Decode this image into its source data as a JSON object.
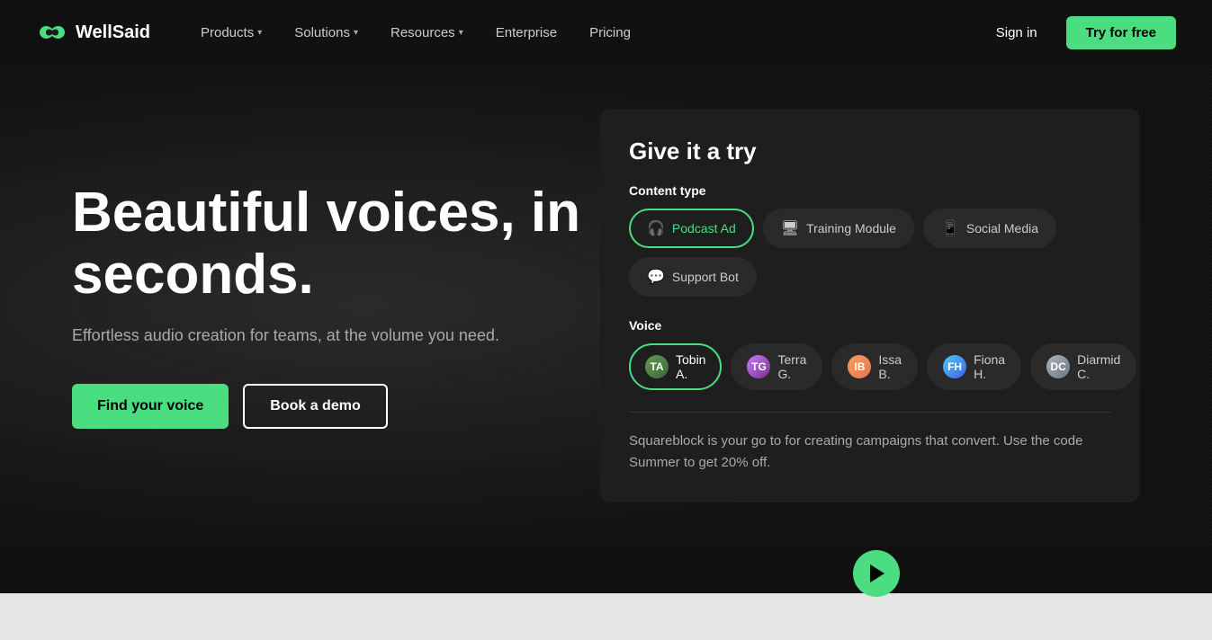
{
  "brand": {
    "name": "WellSaid",
    "logo_alt": "WellSaid logo"
  },
  "nav": {
    "items": [
      {
        "label": "Products",
        "has_dropdown": true
      },
      {
        "label": "Solutions",
        "has_dropdown": true
      },
      {
        "label": "Resources",
        "has_dropdown": true
      },
      {
        "label": "Enterprise",
        "has_dropdown": false
      },
      {
        "label": "Pricing",
        "has_dropdown": false
      }
    ],
    "sign_in": "Sign in",
    "try_free": "Try for free"
  },
  "hero": {
    "title": "Beautiful voices, in seconds.",
    "subtitle": "Effortless audio creation for teams, at the volume you need.",
    "btn_find_voice": "Find your voice",
    "btn_book_demo": "Book a demo"
  },
  "card": {
    "title": "Give it a try",
    "content_type_label": "Content type",
    "content_types": [
      {
        "id": "podcast",
        "label": "Podcast Ad",
        "icon": "🎧",
        "active": true
      },
      {
        "id": "training",
        "label": "Training Module",
        "icon": "🖥",
        "active": false
      },
      {
        "id": "social",
        "label": "Social Media",
        "icon": "📱",
        "active": false
      },
      {
        "id": "support",
        "label": "Support Bot",
        "icon": "💬",
        "active": false
      }
    ],
    "voice_label": "Voice",
    "voices": [
      {
        "id": "tobin",
        "label": "Tobin A.",
        "initials": "TA",
        "active": true
      },
      {
        "id": "terra",
        "label": "Terra G.",
        "initials": "TG",
        "active": false
      },
      {
        "id": "issa",
        "label": "Issa B.",
        "initials": "IB",
        "active": false
      },
      {
        "id": "fiona",
        "label": "Fiona H.",
        "initials": "FH",
        "active": false
      },
      {
        "id": "diarmid",
        "label": "Diarmid C.",
        "initials": "DC",
        "active": false
      }
    ],
    "promo_text": "Squareblock is your go to for creating campaigns that convert. Use the code Summer to get 20% off."
  }
}
